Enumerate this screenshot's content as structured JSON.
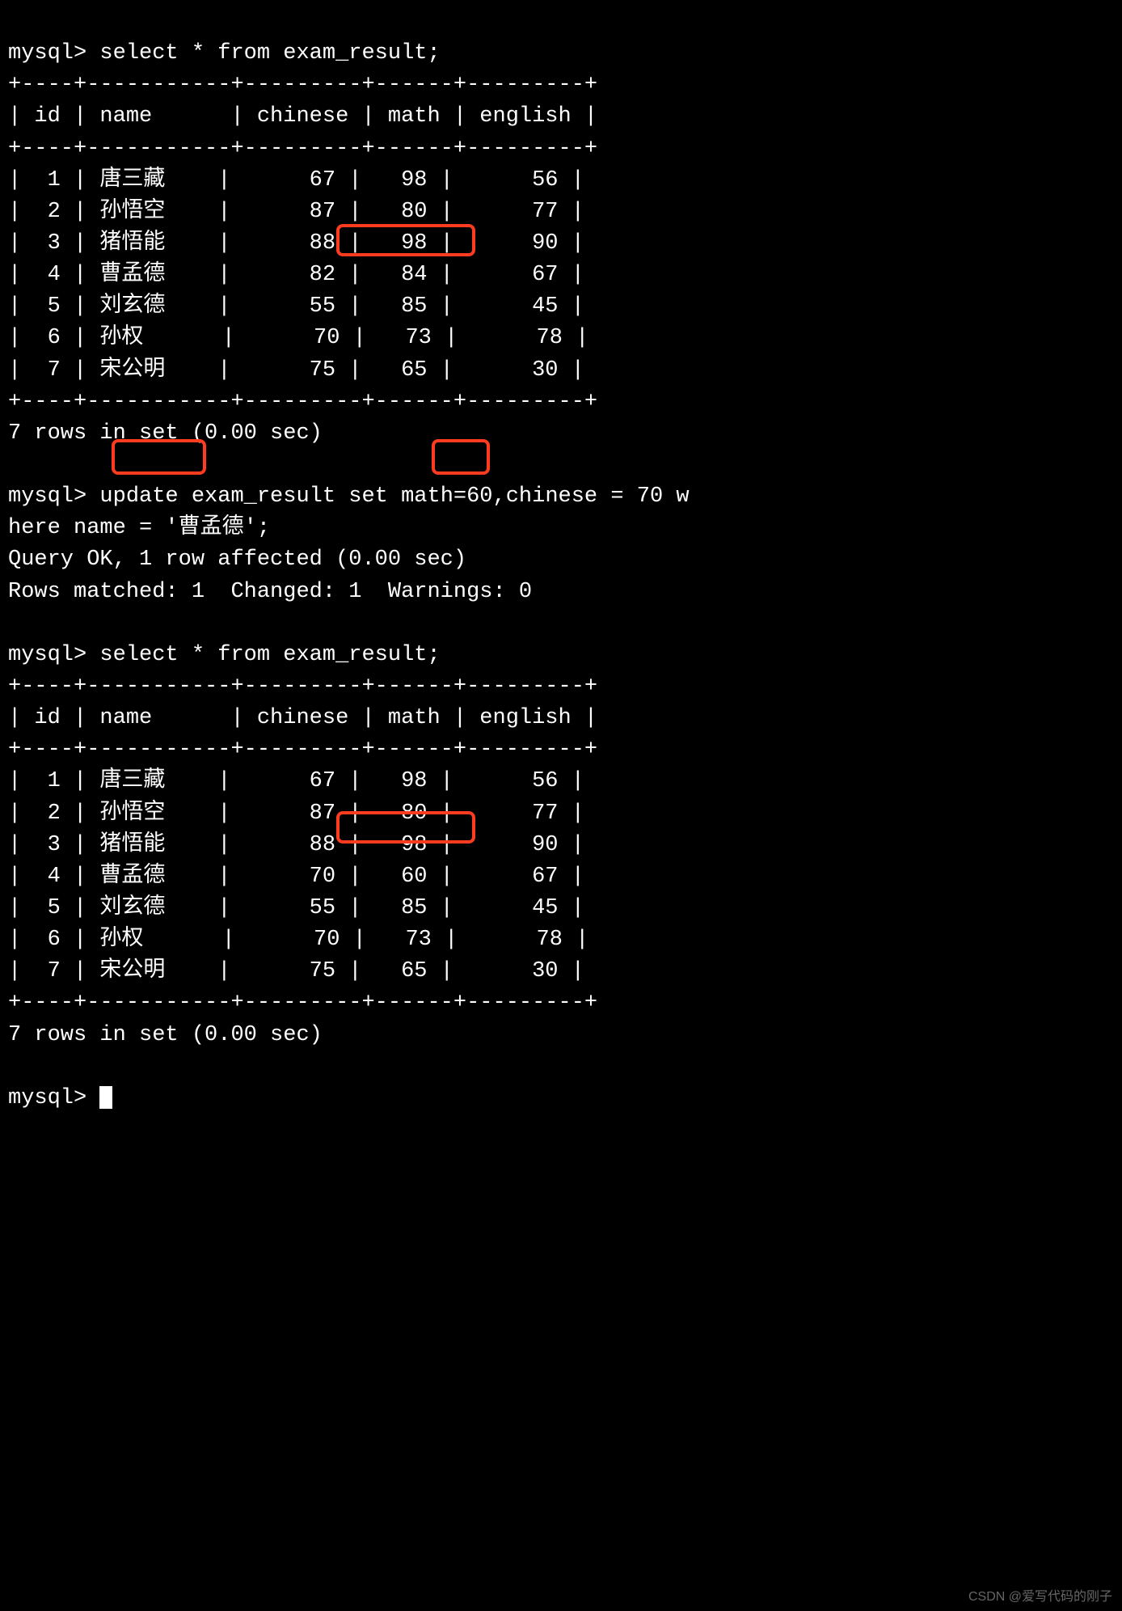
{
  "prompt": "mysql>",
  "query_select": " select * from exam_result;",
  "table_sep": "+----+-----------+---------+------+---------+",
  "table_header": "| id | name      | chinese | math | english |",
  "rows_before": [
    "|  1 | 唐三藏    |      67 |   98 |      56 |",
    "|  2 | 孙悟空    |      87 |   80 |      77 |",
    "|  3 | 猪悟能    |      88 |   98 |      90 |",
    "|  4 | 曹孟德    |      82 |   84 |      67 |",
    "|  5 | 刘玄德    |      55 |   85 |      45 |",
    "|  6 | 孙权      |      70 |   73 |      78 |",
    "|  7 | 宋公明    |      75 |   65 |      30 |"
  ],
  "rows_in_set": "7 rows in set (0.00 sec)",
  "update_line1_pre": " ",
  "update_kw": "update",
  "update_mid": " exam_result ",
  "set_kw": "set",
  "update_line1_post": " math=60,chinese = 70 w",
  "update_line2": "here name = '曹孟德';",
  "query_ok": "Query OK, 1 row affected (0.00 sec)",
  "rows_matched": "Rows matched: 1  Changed: 1  Warnings: 0",
  "rows_after": [
    "|  1 | 唐三藏    |      67 |   98 |      56 |",
    "|  2 | 孙悟空    |      87 |   80 |      77 |",
    "|  3 | 猪悟能    |      88 |   98 |      90 |",
    "|  4 | 曹孟德    |      70 |   60 |      67 |",
    "|  5 | 刘玄德    |      55 |   85 |      45 |",
    "|  6 | 孙权      |      70 |   73 |      78 |",
    "|  7 | 宋公明    |      75 |   65 |      30 |"
  ],
  "watermark": "CSDN @爱写代码的刚子",
  "chart_data": {
    "type": "table",
    "title": "exam_result",
    "columns": [
      "id",
      "name",
      "chinese",
      "math",
      "english"
    ],
    "before_update": [
      {
        "id": 1,
        "name": "唐三藏",
        "chinese": 67,
        "math": 98,
        "english": 56
      },
      {
        "id": 2,
        "name": "孙悟空",
        "chinese": 87,
        "math": 80,
        "english": 77
      },
      {
        "id": 3,
        "name": "猪悟能",
        "chinese": 88,
        "math": 98,
        "english": 90
      },
      {
        "id": 4,
        "name": "曹孟德",
        "chinese": 82,
        "math": 84,
        "english": 67
      },
      {
        "id": 5,
        "name": "刘玄德",
        "chinese": 55,
        "math": 85,
        "english": 45
      },
      {
        "id": 6,
        "name": "孙权",
        "chinese": 70,
        "math": 73,
        "english": 78
      },
      {
        "id": 7,
        "name": "宋公明",
        "chinese": 75,
        "math": 65,
        "english": 30
      }
    ],
    "update_statement": "update exam_result set math=60,chinese = 70 where name = '曹孟德';",
    "after_update": [
      {
        "id": 1,
        "name": "唐三藏",
        "chinese": 67,
        "math": 98,
        "english": 56
      },
      {
        "id": 2,
        "name": "孙悟空",
        "chinese": 87,
        "math": 80,
        "english": 77
      },
      {
        "id": 3,
        "name": "猪悟能",
        "chinese": 88,
        "math": 98,
        "english": 90
      },
      {
        "id": 4,
        "name": "曹孟德",
        "chinese": 70,
        "math": 60,
        "english": 67
      },
      {
        "id": 5,
        "name": "刘玄德",
        "chinese": 55,
        "math": 85,
        "english": 45
      },
      {
        "id": 6,
        "name": "孙权",
        "chinese": 70,
        "math": 73,
        "english": 78
      },
      {
        "id": 7,
        "name": "宋公明",
        "chinese": 75,
        "math": 65,
        "english": 30
      }
    ]
  }
}
